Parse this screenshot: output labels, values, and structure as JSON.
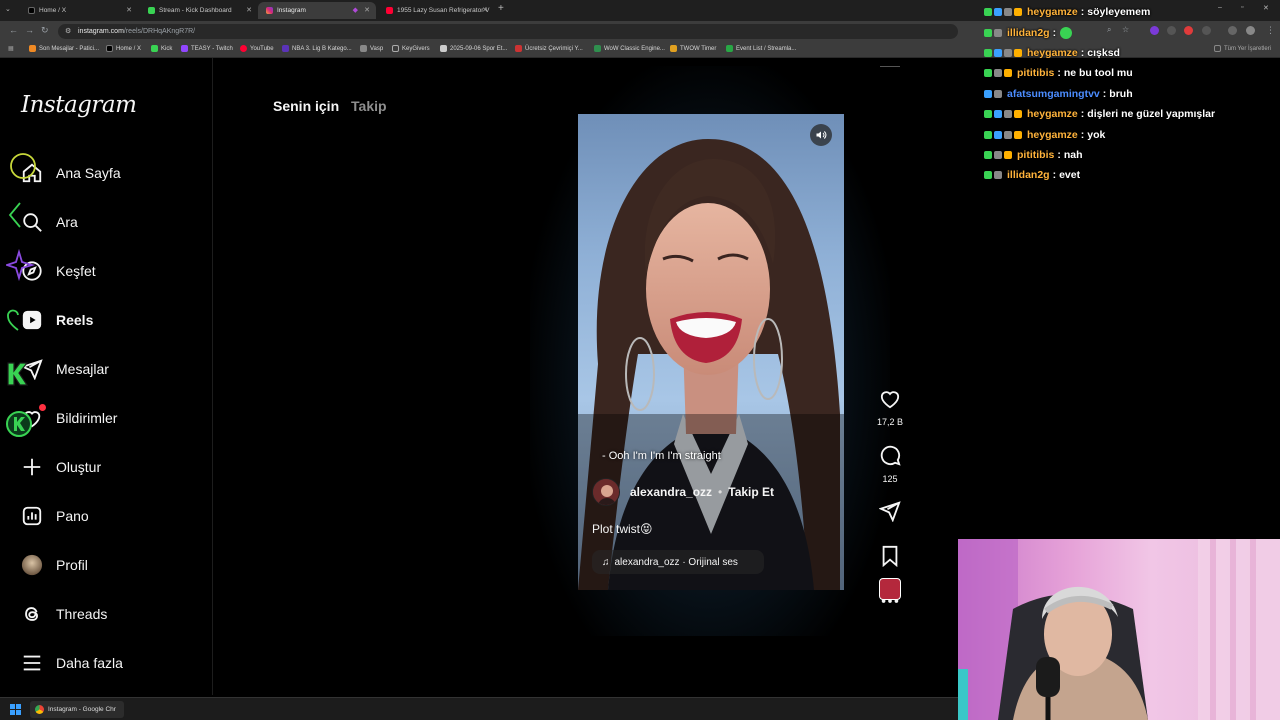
{
  "browser": {
    "tabs": [
      {
        "title": "Home / X",
        "favicon": "x-icon",
        "active": false
      },
      {
        "title": "Stream - Kick Dashboard",
        "favicon": "kick-icon",
        "active": false
      },
      {
        "title": "Instagram",
        "favicon": "instagram-icon",
        "active": true
      },
      {
        "title": "1955 Lazy Susan Refrigerator V",
        "favicon": "youtube-icon",
        "active": false
      }
    ],
    "url_host": "instagram.com",
    "url_path": "/reels/DRHqAKngR7R/",
    "bookmarks": [
      "Son Mesajlar - Patici...",
      "Home / X",
      "Kick",
      "TEASY - Twitch",
      "YouTube",
      "NBA 3. Lig B Katego...",
      "Vasp",
      "KeyGivers",
      "2025-09-06 Spor Et...",
      "Ücretsiz Çevrimiçi Y...",
      "WoW Classic Engine...",
      "TWOW Timer",
      "Event List / Streamla..."
    ],
    "all_bookmarks": "Tüm Yer İşaretleri"
  },
  "instagram": {
    "logo": "Instagram",
    "nav": [
      {
        "label": "Ana Sayfa",
        "icon": "home-icon",
        "bold": false
      },
      {
        "label": "Ara",
        "icon": "search-icon",
        "bold": false
      },
      {
        "label": "Keşfet",
        "icon": "compass-icon",
        "bold": false
      },
      {
        "label": "Reels",
        "icon": "reels-icon",
        "bold": true
      },
      {
        "label": "Mesajlar",
        "icon": "messenger-icon",
        "bold": false
      },
      {
        "label": "Bildirimler",
        "icon": "heart-icon",
        "bold": false
      },
      {
        "label": "Oluştur",
        "icon": "plus-icon",
        "bold": false
      },
      {
        "label": "Pano",
        "icon": "dashboard-icon",
        "bold": false
      },
      {
        "label": "Profil",
        "icon": "avatar",
        "bold": false
      },
      {
        "label": "Threads",
        "icon": "threads-icon",
        "bold": false
      },
      {
        "label": "Daha fazla",
        "icon": "menu-icon",
        "bold": false
      }
    ],
    "feed_tabs": {
      "active": "Senin için",
      "inactive": "Takip"
    },
    "reel": {
      "subtitle": "- Ooh I'm I'm I'm straight",
      "author": "alexandra_ozz",
      "separator": "•",
      "follow_label": "Takip Et",
      "caption": "Plot twist😝",
      "audio": "alexandra_ozz · Orijinal ses",
      "likes": "17,2 B",
      "comments": "125"
    }
  },
  "chat": [
    {
      "user": "heygamze",
      "msg": "söyleyemem",
      "color": "#ffb33b",
      "badges": [
        "#39d353",
        "#3aa0ff",
        "#888888",
        "#ffb000"
      ]
    },
    {
      "user": "illidan2g",
      "msg": "",
      "color": "#ffb33b",
      "badges": [
        "#39d353",
        "#888888"
      ],
      "emote": true
    },
    {
      "user": "heygamze",
      "msg": "cışksd",
      "color": "#ffb33b",
      "badges": [
        "#39d353",
        "#3aa0ff",
        "#888888",
        "#ffb000"
      ]
    },
    {
      "user": "pititibis",
      "msg": "ne bu tool mu",
      "color": "#ffb33b",
      "badges": [
        "#39d353",
        "#888888",
        "#ffb000"
      ]
    },
    {
      "user": "afatsumgamingtvv",
      "msg": "bruh",
      "color": "#4c8dff",
      "badges": [
        "#3aa0ff",
        "#888888"
      ]
    },
    {
      "user": "heygamze",
      "msg": "dişleri ne güzel yapmışlar",
      "color": "#ffb33b",
      "badges": [
        "#39d353",
        "#3aa0ff",
        "#888888",
        "#ffb000"
      ]
    },
    {
      "user": "heygamze",
      "msg": "yok",
      "color": "#ffb33b",
      "badges": [
        "#39d353",
        "#3aa0ff",
        "#888888",
        "#ffb000"
      ]
    },
    {
      "user": "pititibis",
      "msg": "nah",
      "color": "#ffb33b",
      "badges": [
        "#39d353",
        "#888888",
        "#ffb000"
      ]
    },
    {
      "user": "illidan2g",
      "msg": "evet",
      "color": "#ffb33b",
      "badges": [
        "#39d353",
        "#888888"
      ]
    }
  ],
  "taskbar": {
    "chrome_window": "Instagram - Google Chr"
  }
}
